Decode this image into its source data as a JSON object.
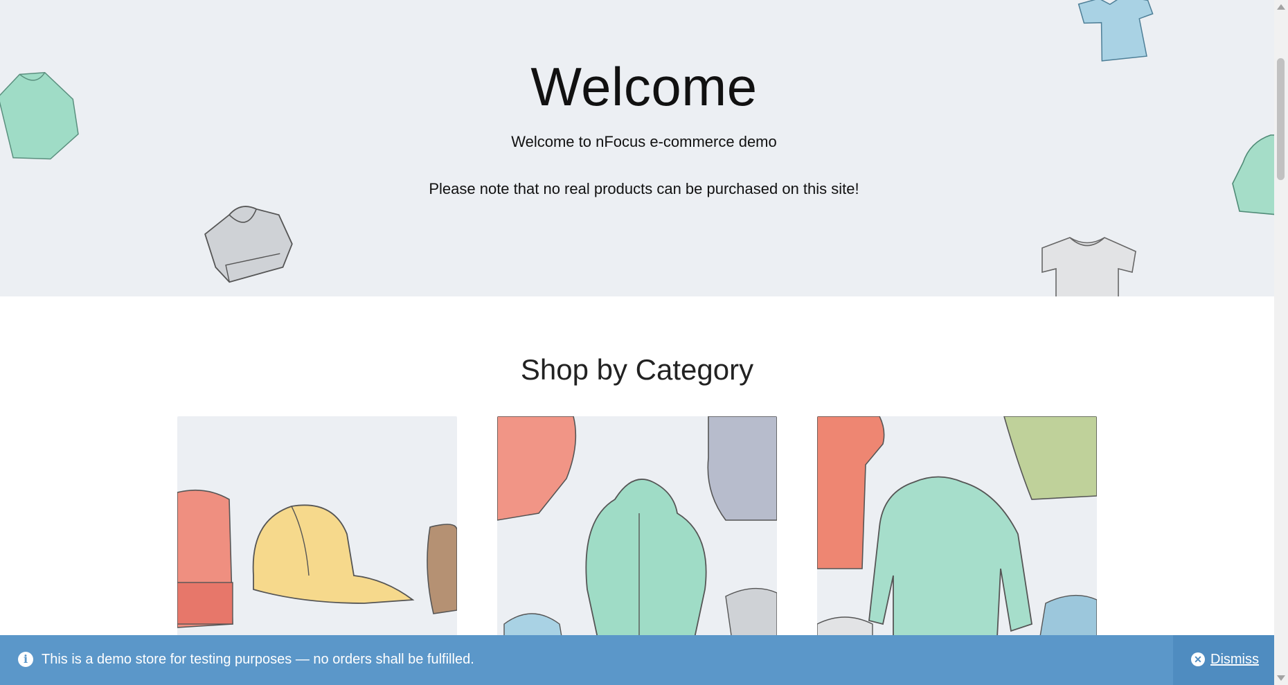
{
  "hero": {
    "title": "Welcome",
    "subtitle": "Welcome to nFocus e-commerce demo",
    "note": "Please note that no real products can be purchased on this site!"
  },
  "categories": {
    "heading": "Shop by Category",
    "cards": [
      {
        "icon": "accessories-image"
      },
      {
        "icon": "hoodies-image"
      },
      {
        "icon": "tshirts-image"
      }
    ]
  },
  "notice": {
    "icon": "info-icon",
    "text": "This is a demo store for testing purposes — no orders shall be fulfilled.",
    "dismiss_icon": "close-icon",
    "dismiss_label": "Dismiss",
    "color": "#5b97c9"
  },
  "colors": {
    "hero_bg": "#eceff3",
    "mint": "#8fd3bd",
    "coral": "#ef8a78",
    "yellow": "#f4d487",
    "gray": "#c9ccd1",
    "blue": "#9cc7dc",
    "olive": "#b8c98a"
  }
}
